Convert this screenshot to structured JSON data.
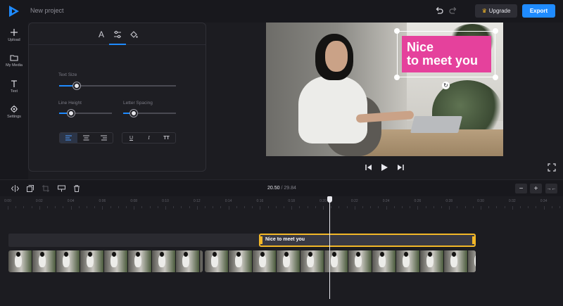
{
  "app": {
    "project_title": "New project",
    "upgrade_label": "Upgrade",
    "export_label": "Export",
    "colors": {
      "accent": "#1f8bff",
      "highlight": "#f2b728",
      "text_card": "#e5419c"
    }
  },
  "rail": {
    "items": [
      {
        "label": "Upload",
        "icon": "plus-icon"
      },
      {
        "label": "My Media",
        "icon": "folder-icon"
      },
      {
        "label": "Text",
        "icon": "text-icon"
      },
      {
        "label": "Settings",
        "icon": "gear-icon"
      }
    ]
  },
  "panel": {
    "tabs": [
      {
        "icon": "font-icon",
        "glyph": "A"
      },
      {
        "icon": "sliders-icon",
        "active": true
      },
      {
        "icon": "fill-color-icon"
      }
    ],
    "text_size": {
      "label": "Text Size",
      "value": 0.15
    },
    "line_height": {
      "label": "Line Height",
      "value": 0.23
    },
    "letter_spacing": {
      "label": "Letter Spacing",
      "value": 0.2
    },
    "align_buttons": [
      {
        "icon": "align-left-icon",
        "active": true
      },
      {
        "icon": "align-center-icon"
      },
      {
        "icon": "align-right-icon"
      }
    ],
    "style_buttons": [
      {
        "icon": "underline-icon",
        "glyph": "U"
      },
      {
        "icon": "italic-icon",
        "glyph": "I"
      },
      {
        "icon": "uppercase-icon",
        "glyph": "TT"
      }
    ]
  },
  "preview": {
    "overlay_text": "Nice to meet you",
    "overlay_line1": "Nice",
    "overlay_line2": "to meet you"
  },
  "timeline": {
    "current_time": "20.50",
    "separator": " / ",
    "duration": "29.84",
    "ticks": [
      "0:00",
      "0:02",
      "0:04",
      "0:06",
      "0:08",
      "0:10",
      "0:12",
      "0:14",
      "0:16",
      "0:18",
      "0:20",
      "0:22",
      "0:24",
      "0:26",
      "0:28",
      "0:30",
      "0:32",
      "0:34"
    ],
    "text_clip_label": "Nice to meet you",
    "zoom_out": "−",
    "zoom_in": "+",
    "fit": "→←"
  }
}
